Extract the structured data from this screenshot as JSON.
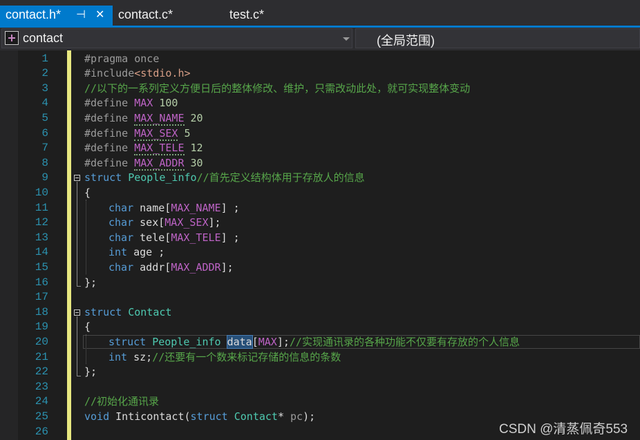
{
  "tabs": [
    {
      "label": "contact.h*",
      "active": true
    },
    {
      "label": "contact.c*",
      "active": false
    },
    {
      "label": "test.c*",
      "active": false
    }
  ],
  "tab_icons": {
    "pin": "⊣",
    "close": "✕"
  },
  "nav": {
    "project": "contact",
    "scope": "(全局范围)"
  },
  "lines": [
    {
      "n": "1",
      "t": [
        "#pragma once"
      ]
    },
    {
      "n": "2",
      "t": [
        "#include",
        "<stdio.h>"
      ]
    },
    {
      "n": "3",
      "t": [
        "//以下的一系列定义方便日后的整体修改、维护，只需改动此处，就可实现整体变动"
      ]
    },
    {
      "n": "4",
      "t": [
        "#define ",
        "MAX",
        " 100"
      ]
    },
    {
      "n": "5",
      "t": [
        "#define ",
        "MAX_NAME",
        " 20"
      ]
    },
    {
      "n": "6",
      "t": [
        "#define ",
        "MAX_SEX",
        " 5"
      ]
    },
    {
      "n": "7",
      "t": [
        "#define ",
        "MAX_TELE",
        " 12"
      ]
    },
    {
      "n": "8",
      "t": [
        "#define ",
        "MAX_ADDR",
        " 30"
      ]
    },
    {
      "n": "9",
      "t": [
        "struct",
        " ",
        "People_info",
        "//首先定义结构体用于存放人的信息"
      ]
    },
    {
      "n": "10",
      "t": [
        "{"
      ]
    },
    {
      "n": "11",
      "t": [
        "char",
        " name[",
        "MAX_NAME",
        "] ;"
      ]
    },
    {
      "n": "12",
      "t": [
        "char",
        " sex[",
        "MAX_SEX",
        "];"
      ]
    },
    {
      "n": "13",
      "t": [
        "char",
        " tele[",
        "MAX_TELE",
        "] ;"
      ]
    },
    {
      "n": "14",
      "t": [
        "int",
        " age ;"
      ]
    },
    {
      "n": "15",
      "t": [
        "char",
        " addr[",
        "MAX_ADDR",
        "];"
      ]
    },
    {
      "n": "16",
      "t": [
        "};"
      ]
    },
    {
      "n": "17",
      "t": []
    },
    {
      "n": "18",
      "t": [
        "struct",
        " ",
        "Contact"
      ]
    },
    {
      "n": "19",
      "t": [
        "{"
      ]
    },
    {
      "n": "20",
      "t": [
        "struct",
        " ",
        "People_info",
        " ",
        "data",
        "[",
        "MAX",
        "];",
        "//实现通讯录的各种功能不仅要有存放的个人信息"
      ]
    },
    {
      "n": "21",
      "t": [
        "int",
        " sz;",
        "//还要有一个数来标记存储的信息的条数"
      ]
    },
    {
      "n": "22",
      "t": [
        "};"
      ]
    },
    {
      "n": "23",
      "t": []
    },
    {
      "n": "24",
      "t": [
        "//初始化通讯录"
      ]
    },
    {
      "n": "25",
      "t": [
        "void",
        " Inticontact(",
        "struct",
        " ",
        "Contact",
        "* ",
        "pc",
        ");"
      ]
    },
    {
      "n": "26",
      "t": []
    }
  ],
  "watermark": "CSDN @清蒸佩奇553",
  "colors": {
    "accent": "#007acc",
    "keyword": "#569cd6",
    "type": "#4ec9b0",
    "macro": "#bd63c5",
    "number": "#b5cea8",
    "string": "#d69d85",
    "comment": "#57a64a",
    "line_number": "#2b91af",
    "change_bar": "#e8e880"
  }
}
